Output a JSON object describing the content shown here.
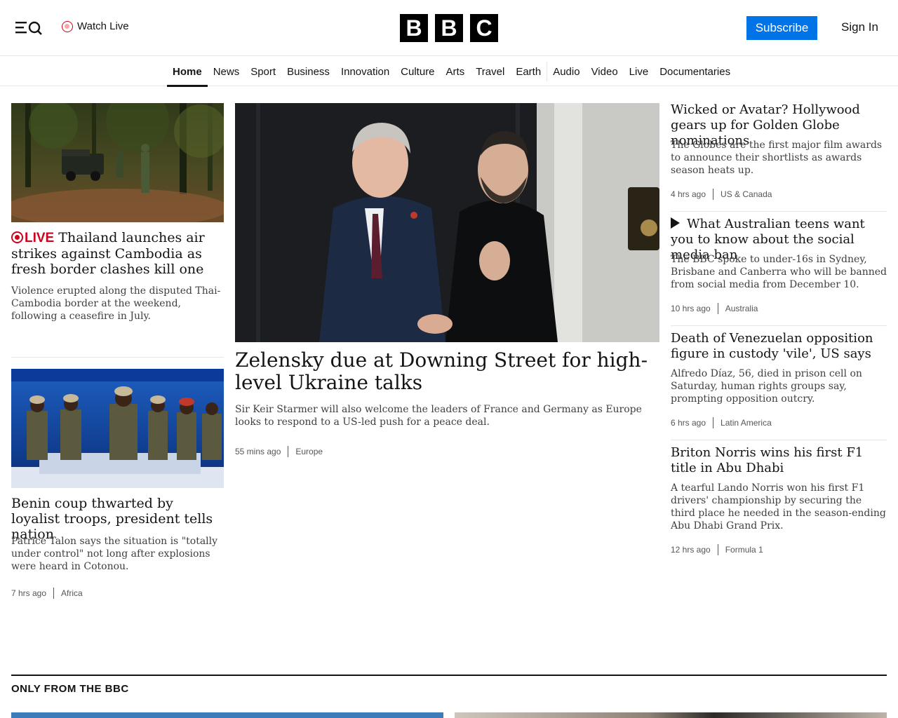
{
  "header": {
    "watch_live": "Watch Live",
    "logo_letters": [
      "B",
      "B",
      "C"
    ],
    "subscribe": "Subscribe",
    "sign_in": "Sign In",
    "accent_color": "#0073e6"
  },
  "nav": {
    "items": [
      "Home",
      "News",
      "Sport",
      "Business",
      "Innovation",
      "Culture",
      "Arts",
      "Travel",
      "Earth",
      "Audio",
      "Video",
      "Live",
      "Documentaries"
    ],
    "active": "Home"
  },
  "left": {
    "story1": {
      "live_label": "LIVE",
      "headline": "Thailand launches air strikes against Cambodia as fresh border clashes kill one",
      "summary": "Violence erupted along the disputed Thai-Cambodia border at the weekend, following a ceasefire in July."
    },
    "story2": {
      "headline": "Benin coup thwarted by loyalist troops, president tells nation",
      "summary": "Patrice Talon says the situation is \"totally under control\" not long after explosions were heard in Cotonou.",
      "time": "7 hrs ago",
      "category": "Africa"
    }
  },
  "main": {
    "headline": "Zelensky due at Downing Street for high-level Ukraine talks",
    "summary": "Sir Keir Starmer will also welcome the leaders of France and Germany as Europe looks to respond to a US-led push for a peace deal.",
    "time": "55 mins ago",
    "category": "Europe"
  },
  "right": [
    {
      "headline": "Wicked or Avatar? Hollywood gears up for Golden Globe nominations",
      "summary": "The Globes are the first major film awards to announce their shortlists as awards season heats up.",
      "time": "4 hrs ago",
      "category": "US & Canada"
    },
    {
      "headline": "What Australian teens want you to know about the social media ban",
      "summary": "The BBC spoke to under-16s in Sydney, Brisbane and Canberra who will be banned from social media from December 10.",
      "time": "10 hrs ago",
      "category": "Australia"
    },
    {
      "headline": "Death of Venezuelan opposition figure in custody 'vile', US says",
      "summary": "Alfredo Díaz, 56, died in prison cell on Saturday, human rights groups say, prompting opposition outcry.",
      "time": "6 hrs ago",
      "category": "Latin America"
    },
    {
      "headline": "Briton Norris wins his first F1 title in Abu Dhabi",
      "summary": "A tearful Lando Norris won his first F1 drivers' championship by securing the third place he needed in the season-ending Abu Dhabi Grand Prix.",
      "time": "12 hrs ago",
      "category": "Formula 1"
    }
  ],
  "section": {
    "title": "ONLY FROM THE BBC"
  }
}
